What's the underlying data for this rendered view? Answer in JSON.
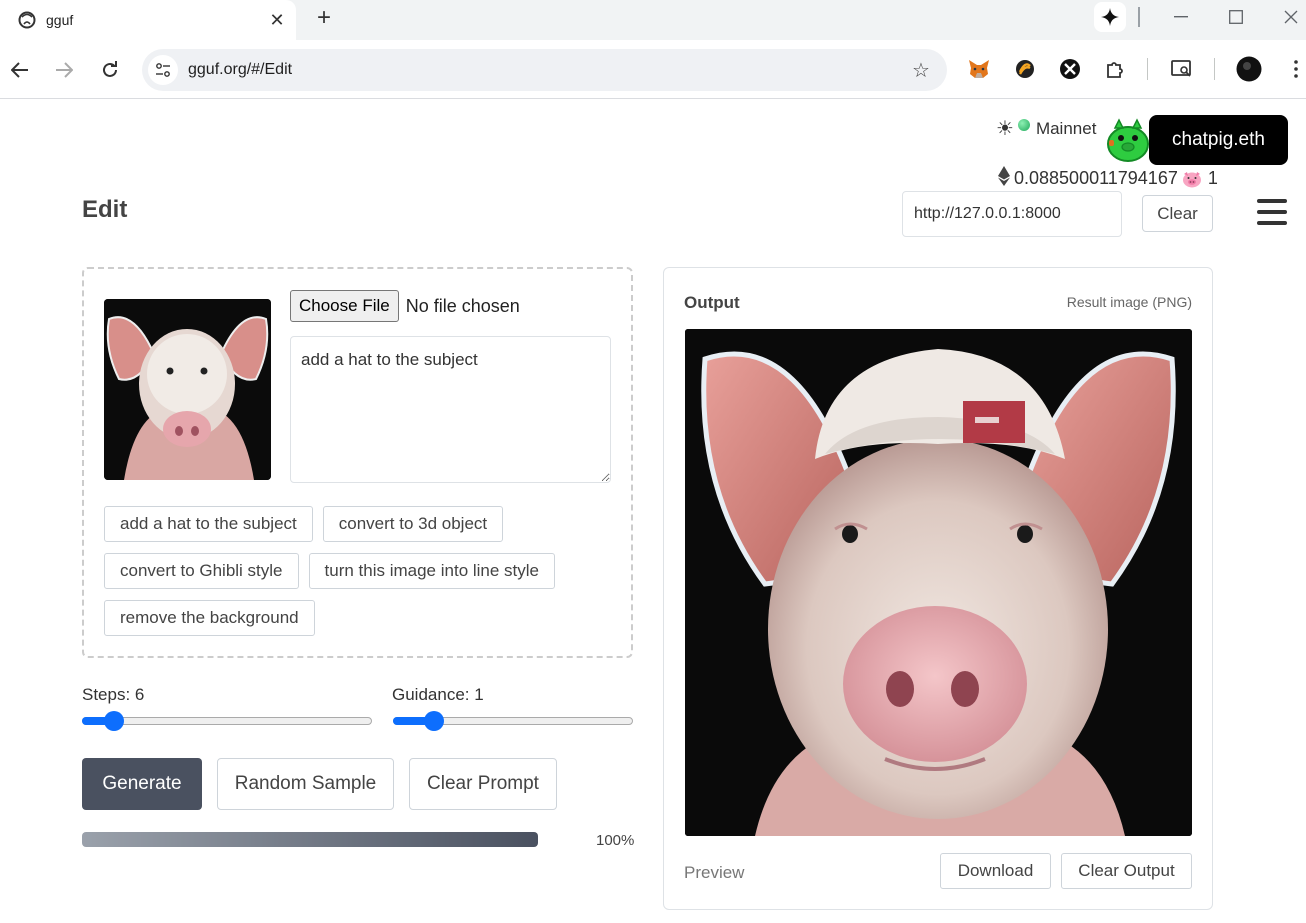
{
  "browser": {
    "tab_title": "gguf",
    "url": "gguf.org/#/Edit",
    "new_tab": "+",
    "close_tab": "✕"
  },
  "header": {
    "network": "Mainnet",
    "ens_name": "chatpig.eth",
    "eth_balance": "0.088500011794167",
    "pig_count": "1",
    "server_url": "http://127.0.0.1:8000",
    "clear_label": "Clear"
  },
  "page": {
    "title": "Edit"
  },
  "input": {
    "choose_file": "Choose File",
    "no_file": "No file chosen",
    "prompt": "add a hat to the subject",
    "suggestions": [
      "add a hat to the subject",
      "convert to 3d object",
      "convert to Ghibli style",
      "turn this image into line style",
      "remove the background"
    ]
  },
  "controls": {
    "steps_label": "Steps: 6",
    "steps_level": 0.08,
    "guidance_label": "Guidance: 1",
    "guidance_level": 0.14,
    "generate": "Generate",
    "random_sample": "Random Sample",
    "clear_prompt": "Clear Prompt",
    "progress_percent": 100,
    "progress_text": "100%"
  },
  "output": {
    "title": "Output",
    "subtitle": "Result image (PNG)",
    "preview": "Preview",
    "download": "Download",
    "clear_output": "Clear Output"
  },
  "colors": {
    "accent": "#0d6efd",
    "generate_bg": "#4a5160",
    "ens_bg": "#000000"
  }
}
